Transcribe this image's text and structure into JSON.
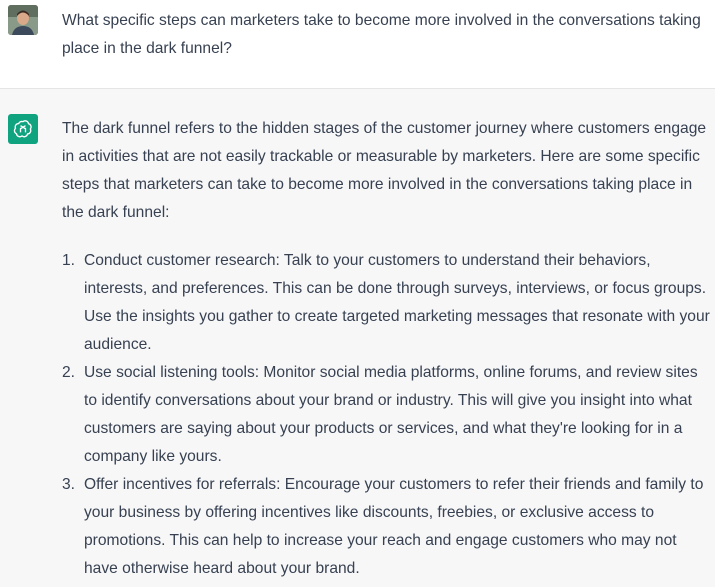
{
  "user": {
    "avatar_icon": "user-avatar-photo",
    "message": "What specific steps can marketers take to become more involved in the conversations taking place in the dark funnel?"
  },
  "assistant": {
    "icon": "openai-logo-icon",
    "icon_color": "#10a37f",
    "intro": "The dark funnel refers to the hidden stages of the customer journey where customers engage in activities that are not easily trackable or measurable by marketers. Here are some specific steps that marketers can take to become more involved in the conversations taking place in the dark funnel:",
    "steps": [
      {
        "number": "1.",
        "text": "Conduct customer research: Talk to your customers to understand their behaviors, interests, and preferences. This can be done through surveys, interviews, or focus groups. Use the insights you gather to create targeted marketing messages that resonate with your audience."
      },
      {
        "number": "2.",
        "text": "Use social listening tools: Monitor social media platforms, online forums, and review sites to identify conversations about your brand or industry. This will give you insight into what customers are saying about your products or services, and what they're looking for in a company like yours."
      },
      {
        "number": "3.",
        "text": "Offer incentives for referrals: Encourage your customers to refer their friends and family to your business by offering incentives like discounts, freebies, or exclusive access to promotions. This can help to increase your reach and engage customers who may not have otherwise heard about your brand."
      }
    ]
  }
}
